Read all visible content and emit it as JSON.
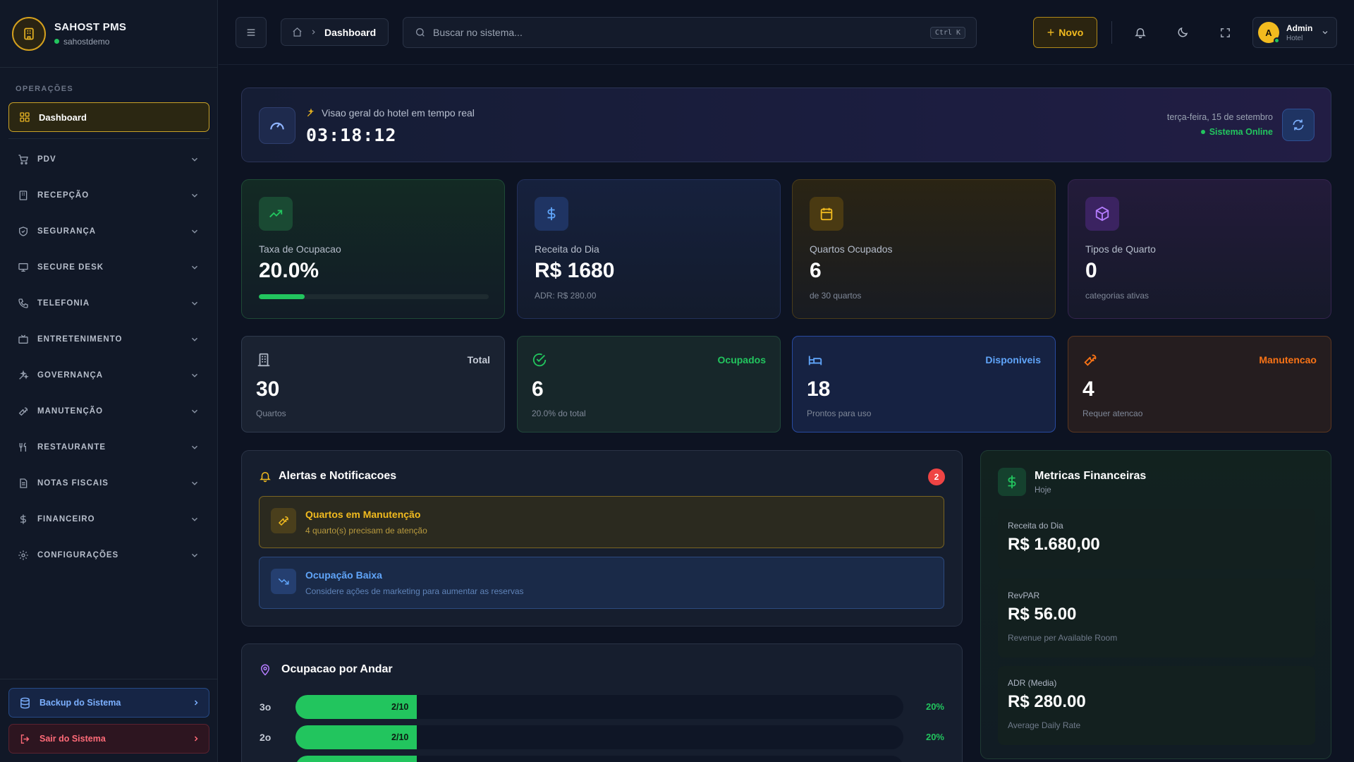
{
  "brand": {
    "name": "SAHOST PMS",
    "tenant": "sahostdemo"
  },
  "sidebar": {
    "section": "OPERAÇÕES",
    "active": "Dashboard",
    "items": [
      {
        "label": "PDV",
        "icon": "cart-icon"
      },
      {
        "label": "RECEPÇÃO",
        "icon": "building-icon"
      },
      {
        "label": "SEGURANÇA",
        "icon": "shield-icon"
      },
      {
        "label": "SECURE DESK",
        "icon": "monitor-icon"
      },
      {
        "label": "TELEFONIA",
        "icon": "phone-icon"
      },
      {
        "label": "ENTRETENIMENTO",
        "icon": "tv-icon"
      },
      {
        "label": "GOVERNANÇA",
        "icon": "sparkles-icon"
      },
      {
        "label": "MANUTENÇÃO",
        "icon": "wrench-icon"
      },
      {
        "label": "RESTAURANTE",
        "icon": "utensils-icon"
      },
      {
        "label": "NOTAS FISCAIS",
        "icon": "file-icon"
      },
      {
        "label": "FINANCEIRO",
        "icon": "dollar-icon"
      },
      {
        "label": "CONFIGURAÇÕES",
        "icon": "gear-icon"
      }
    ],
    "backup_label": "Backup do Sistema",
    "logout_label": "Sair do Sistema"
  },
  "header": {
    "breadcrumb_current": "Dashboard",
    "search_placeholder": "Buscar no sistema...",
    "search_shortcut": "Ctrl K",
    "new_label": "Novo",
    "user_name": "Admin",
    "user_role": "Hotel",
    "user_initial": "A"
  },
  "banner": {
    "subtitle": "Visao geral do hotel em tempo real",
    "clock": "03:18:12",
    "date": "terça-feira, 15 de setembro",
    "status": "Sistema Online"
  },
  "cards": [
    {
      "label": "Taxa de Ocupacao",
      "value": "20.0%",
      "progress": 0.2
    },
    {
      "label": "Receita do Dia",
      "value": "R$ 1680",
      "sub": "ADR: R$ 280.00"
    },
    {
      "label": "Quartos Ocupados",
      "value": "6",
      "sub": "de 30 quartos"
    },
    {
      "label": "Tipos de Quarto",
      "value": "0",
      "sub": "categorias ativas"
    }
  ],
  "status_cards": [
    {
      "tag": "Total",
      "value": "30",
      "sub": "Quartos"
    },
    {
      "tag": "Ocupados",
      "value": "6",
      "sub": "20.0% do total"
    },
    {
      "tag": "Disponiveis",
      "value": "18",
      "sub": "Prontos para uso"
    },
    {
      "tag": "Manutencao",
      "value": "4",
      "sub": "Requer atencao"
    }
  ],
  "alerts": {
    "title": "Alertas e Notificacoes",
    "count": "2",
    "items": [
      {
        "title": "Quartos em Manutenção",
        "text": "4 quarto(s) precisam de atenção"
      },
      {
        "title": "Ocupação Baixa",
        "text": "Considere ações de marketing para aumentar as reservas"
      }
    ]
  },
  "floors": {
    "title": "Ocupacao por Andar",
    "rows": [
      {
        "floor": "3o",
        "label": "2/10",
        "percent": "20%",
        "fraction": 0.2
      },
      {
        "floor": "2o",
        "label": "2/10",
        "percent": "20%",
        "fraction": 0.2
      },
      {
        "floor": "",
        "label": "",
        "percent": "",
        "fraction": 0.2
      }
    ]
  },
  "finance": {
    "title": "Metricas Financeiras",
    "period": "Hoje",
    "metrics": [
      {
        "label": "Receita do Dia",
        "value": "R$ 1.680,00",
        "sub": ""
      },
      {
        "label": "RevPAR",
        "value": "R$ 56.00",
        "sub": "Revenue per Available Room"
      },
      {
        "label": "ADR (Media)",
        "value": "R$ 280.00",
        "sub": "Average Daily Rate"
      }
    ]
  },
  "colors": {
    "accent": "#f2bb1f",
    "success": "#22c55e",
    "info": "#60a5fa",
    "warning": "#f59e0b",
    "danger": "#ef4444",
    "purple": "#a855f7"
  }
}
